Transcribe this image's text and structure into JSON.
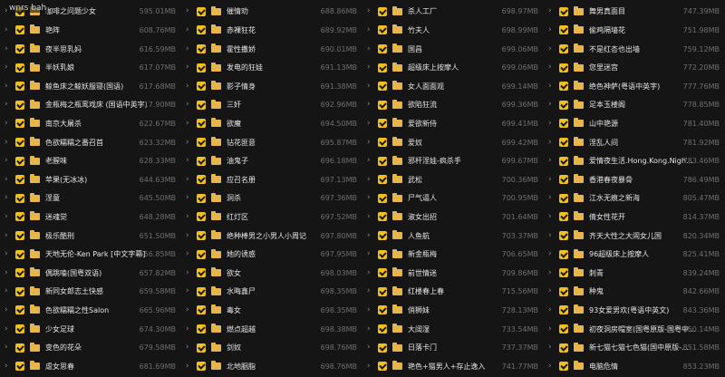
{
  "overlay_text": "wnrs bah",
  "columns": [
    [
      {
        "name": "咖啡之问题少女",
        "size": "595.01MB"
      },
      {
        "name": "艳阵",
        "size": "608.76MB"
      },
      {
        "name": "夜半思乳妈",
        "size": "616.59MB"
      },
      {
        "name": "半妖乳娘",
        "size": "617.07MB"
      },
      {
        "name": "鲸鱼床之鲸妖服寝(国语)",
        "size": "617.68MB"
      },
      {
        "name": "金瓶梅之瓶鸾戏床 (国语中英字)",
        "size": "617.90MB"
      },
      {
        "name": "南京大屠杀",
        "size": "622.67MB"
      },
      {
        "name": "色欲糯糯之番召首",
        "size": "623.32MB"
      },
      {
        "name": "老腥味",
        "size": "628.33MB"
      },
      {
        "name": "苹果(无冰冰)",
        "size": "644.63MB"
      },
      {
        "name": "淫童",
        "size": "645.50MB"
      },
      {
        "name": "迷魂觉",
        "size": "648.28MB"
      },
      {
        "name": "极乐酷刑",
        "size": "651.50MB"
      },
      {
        "name": "天地无伦-Ken Park [中文字幕]",
        "size": "656.85MB"
      },
      {
        "name": "偶跳嗑(国粤双语)",
        "size": "657.82MB"
      },
      {
        "name": "新同女郎志土快感",
        "size": "659.58MB"
      },
      {
        "name": "色欲糯糯之性Salon",
        "size": "665.96MB"
      },
      {
        "name": "少女足球",
        "size": "674.30MB"
      },
      {
        "name": "变色的花朵",
        "size": "679.58MB"
      },
      {
        "name": "虐女思春",
        "size": "681.69MB"
      }
    ],
    [
      {
        "name": "催情劝",
        "size": "688.86MB"
      },
      {
        "name": "赤裸狂花",
        "size": "689.92MB"
      },
      {
        "name": "霍性撒娇",
        "size": "690.01MB"
      },
      {
        "name": "发电的狂娃",
        "size": "691.13MB"
      },
      {
        "name": "影子情身",
        "size": "691.38MB"
      },
      {
        "name": "三奸",
        "size": "692.96MB"
      },
      {
        "name": "欲魔",
        "size": "694.50MB"
      },
      {
        "name": "钻花匪意",
        "size": "695.87MB"
      },
      {
        "name": "油鬼子",
        "size": "696.18MB"
      },
      {
        "name": "应召名册",
        "size": "697.13MB"
      },
      {
        "name": "洞杀",
        "size": "697.36MB"
      },
      {
        "name": "红灯区",
        "size": "697.52MB"
      },
      {
        "name": "绝种棒男之小男人小周记",
        "size": "697.80MB"
      },
      {
        "name": "她的诱惑",
        "size": "697.95MB"
      },
      {
        "name": "欲女",
        "size": "698.03MB"
      },
      {
        "name": "水晦鑫尸",
        "size": "698.35MB"
      },
      {
        "name": "毒女",
        "size": "698.35MB"
      },
      {
        "name": "燃点超越",
        "size": "698.38MB"
      },
      {
        "name": "剑奴",
        "size": "698.76MB"
      },
      {
        "name": "北地胭脂",
        "size": "698.76MB"
      }
    ],
    [
      {
        "name": "杀人工厂",
        "size": "698.97MB"
      },
      {
        "name": "竹夫人",
        "size": "698.99MB"
      },
      {
        "name": "国昌",
        "size": "699.06MB"
      },
      {
        "name": "超级床上按摩人",
        "size": "699.06MB"
      },
      {
        "name": "女人面面观",
        "size": "699.14MB"
      },
      {
        "name": "欲陷狂流",
        "size": "699.36MB"
      },
      {
        "name": "爱欲新侍",
        "size": "699.41MB"
      },
      {
        "name": "爱奴",
        "size": "699.42MB"
      },
      {
        "name": "邪杆淫娃-疯杀手",
        "size": "699.67MB"
      },
      {
        "name": "武松",
        "size": "700.36MB"
      },
      {
        "name": "尸气逼人",
        "size": "700.95MB"
      },
      {
        "name": "淑女出招",
        "size": "701.64MB"
      },
      {
        "name": "人鱼航",
        "size": "703.37MB"
      },
      {
        "name": "新金瓶梅",
        "size": "706.65MB"
      },
      {
        "name": "前世情迷",
        "size": "709.86MB"
      },
      {
        "name": "红楼春上春",
        "size": "715.56MB"
      },
      {
        "name": "俏狮妹",
        "size": "728.13MB"
      },
      {
        "name": "大阔湿",
        "size": "733.54MB"
      },
      {
        "name": "日落卡门",
        "size": "737.37MB"
      },
      {
        "name": "艳色+猫男人+存止逸入",
        "size": "741.77MB"
      }
    ],
    [
      {
        "name": "舞男真面目",
        "size": "747.39MB"
      },
      {
        "name": "偷鸡隔墙花",
        "size": "751.98MB"
      },
      {
        "name": "不是红杏也出墙",
        "size": "759.12MB"
      },
      {
        "name": "您里迷宫",
        "size": "772.20MB"
      },
      {
        "name": "绝色神萨(粤语中英字)",
        "size": "777.76MB"
      },
      {
        "name": "足本玉楼阁",
        "size": "778.85MB"
      },
      {
        "name": "山中艳源",
        "size": "781.40MB"
      },
      {
        "name": "淫乱人间",
        "size": "781.92MB"
      },
      {
        "name": "爱情夜生活.Hong.Kong.Night.G...",
        "size": "783.46MB"
      },
      {
        "name": "香港春夜暴骨",
        "size": "786.49MB"
      },
      {
        "name": "江水无痕之新海",
        "size": "805.47MB"
      },
      {
        "name": "倩女性花开",
        "size": "814.37MB"
      },
      {
        "name": "齐天大性之大闹女儿国",
        "size": "820.34MB"
      },
      {
        "name": "96超级床上按摩人",
        "size": "825.41MB"
      },
      {
        "name": "刺青",
        "size": "839.24MB"
      },
      {
        "name": "种鬼",
        "size": "842.66MB"
      },
      {
        "name": "93女爱男欢(粤语中英文)",
        "size": "843.36MB"
      },
      {
        "name": "初夜洞房帽室(国粤原版-国粤中...",
        "size": "850.14MB"
      },
      {
        "name": "新七猫七猫七色猫(国中原版-国粤中...",
        "size": "851.58MB"
      },
      {
        "name": "电脑危情",
        "size": "853.23MB"
      }
    ]
  ]
}
